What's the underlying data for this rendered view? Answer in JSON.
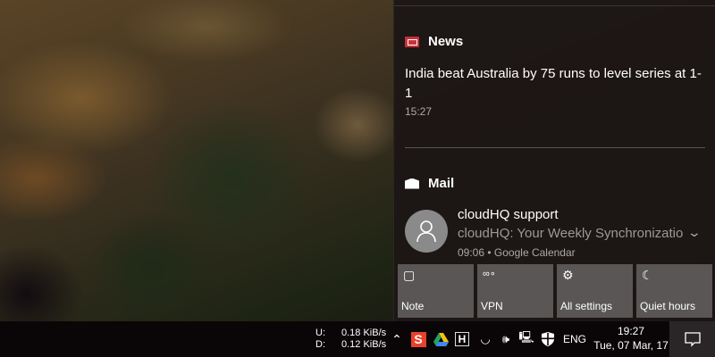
{
  "news": {
    "header": "News",
    "headline": "India beat Australia by 75 runs to level series at 1-1",
    "time": "15:27"
  },
  "mail": {
    "header": "Mail",
    "from": "cloudHQ support",
    "subject": "cloudHQ: Your Weekly Synchronization",
    "time": "09:06",
    "source": "Google Calendar",
    "separator": "•"
  },
  "quick_actions": [
    {
      "label": "Note",
      "icon": "note-icon"
    },
    {
      "label": "VPN",
      "icon": "vpn-icon"
    },
    {
      "label": "All settings",
      "icon": "gear-icon"
    },
    {
      "label": "Quiet hours",
      "icon": "moon-icon"
    }
  ],
  "taskbar": {
    "upload_label": "U:",
    "upload_value": "0.18 KiB/s",
    "download_label": "D:",
    "download_value": "0.12 KiB/s",
    "language": "ENG",
    "time": "19:27",
    "date": "Tue, 07 Mar, 17"
  },
  "colors": {
    "news_accent": "#c8323a",
    "panel_bg": "#1c1615",
    "tile_bg": "#5a5656"
  }
}
